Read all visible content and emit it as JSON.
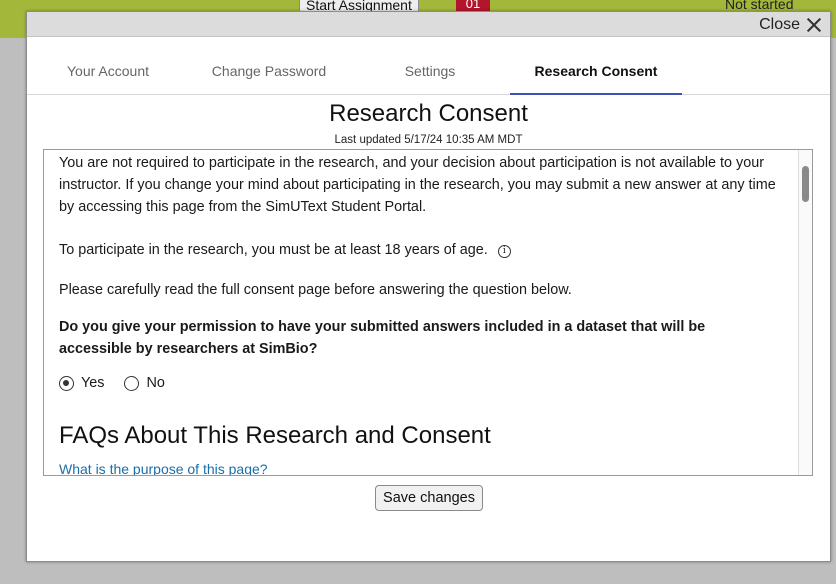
{
  "background": {
    "start_assignment_label": "Start Assignment",
    "badge_text": "01",
    "status_text": "Not started"
  },
  "dialog": {
    "close_label": "Close",
    "tabs": [
      {
        "label": "Your Account",
        "active": false
      },
      {
        "label": "Change Password",
        "active": false
      },
      {
        "label": "Settings",
        "active": false
      },
      {
        "label": "Research Consent",
        "active": true
      }
    ],
    "title": "Research Consent",
    "last_updated": "Last updated 5/17/24 10:35 AM MDT",
    "content": {
      "paragraph1": "You are not required to participate in the research, and your decision about participation is not available to your instructor. If you change your mind about participating in the research, you may submit a new answer at any time by accessing this page from the SimUText Student Portal.",
      "paragraph2": "To participate in the research, you must be at least 18 years of age.",
      "paragraph3": "Please carefully read the full consent page before answering the question below.",
      "question": "Do you give your permission to have your submitted answers included in a dataset that will be accessible by researchers at SimBio?",
      "options": [
        {
          "label": "Yes",
          "selected": true
        },
        {
          "label": "No",
          "selected": false
        }
      ],
      "faq_heading": "FAQs About This Research and Consent",
      "faq_link": "What is the purpose of this page?"
    },
    "save_label": "Save changes"
  },
  "colors": {
    "topbar": "#a3b83b",
    "active_tab_underline": "#3f51b5",
    "link": "#1a6ea8",
    "badge": "#b3162b"
  },
  "icons": [
    "close-icon",
    "info-icon",
    "radio-checked-icon",
    "radio-unchecked-icon"
  ]
}
